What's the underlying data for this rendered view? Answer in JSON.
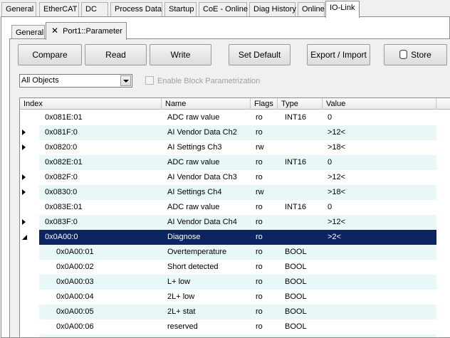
{
  "top_tabs": [
    "General",
    "EtherCAT",
    "DC",
    "Process Data",
    "Startup",
    "CoE - Online",
    "Diag History",
    "Online",
    "IO-Link"
  ],
  "sub_tabs": {
    "general": "General",
    "close_glyph": "✕",
    "parameter": "Port1::Parameter"
  },
  "toolbar": {
    "compare": "Compare",
    "read": "Read",
    "write": "Write",
    "set_default": "Set Default",
    "export_import": "Export / Import",
    "store": "Store"
  },
  "filter": {
    "selected": "All Objects"
  },
  "block_param": {
    "label": "Enable Block Parametrization",
    "checked": false
  },
  "table": {
    "columns": [
      "Index",
      "Name",
      "Flags",
      "Type",
      "Value"
    ],
    "rows": [
      {
        "index": "0x081E:01",
        "name": "ADC raw value",
        "flags": "ro",
        "type": "INT16",
        "value": "0"
      },
      {
        "index": "0x081F:0",
        "name": "AI Vendor Data Ch2",
        "flags": "ro",
        "type": "",
        "value": ">12<"
      },
      {
        "index": "0x0820:0",
        "name": "AI Settings Ch3",
        "flags": "rw",
        "type": "",
        "value": ">18<"
      },
      {
        "index": "0x082E:01",
        "name": "ADC raw value",
        "flags": "ro",
        "type": "INT16",
        "value": "0"
      },
      {
        "index": "0x082F:0",
        "name": "AI Vendor Data Ch3",
        "flags": "ro",
        "type": "",
        "value": ">12<"
      },
      {
        "index": "0x0830:0",
        "name": "AI Settings Ch4",
        "flags": "rw",
        "type": "",
        "value": ">18<"
      },
      {
        "index": "0x083E:01",
        "name": "ADC raw value",
        "flags": "ro",
        "type": "INT16",
        "value": "0"
      },
      {
        "index": "0x083F:0",
        "name": "AI Vendor Data Ch4",
        "flags": "ro",
        "type": "",
        "value": ">12<"
      },
      {
        "index": "0x0A00:0",
        "name": "Diagnose",
        "flags": "ro",
        "type": "",
        "value": ">2<"
      },
      {
        "index": "0x0A00:01",
        "name": "Overtemperature",
        "flags": "ro",
        "type": "BOOL",
        "value": ""
      },
      {
        "index": "0x0A00:02",
        "name": "Short detected",
        "flags": "ro",
        "type": "BOOL",
        "value": ""
      },
      {
        "index": "0x0A00:03",
        "name": "L+ low",
        "flags": "ro",
        "type": "BOOL",
        "value": ""
      },
      {
        "index": "0x0A00:04",
        "name": "2L+ low",
        "flags": "ro",
        "type": "BOOL",
        "value": ""
      },
      {
        "index": "0x0A00:05",
        "name": "2L+ stat",
        "flags": "ro",
        "type": "BOOL",
        "value": ""
      },
      {
        "index": "0x0A00:06",
        "name": "reserved",
        "flags": "ro",
        "type": "BOOL",
        "value": ""
      }
    ]
  },
  "colors": {
    "selection": "#0c2462",
    "alt_row": "#e8f7f8"
  }
}
